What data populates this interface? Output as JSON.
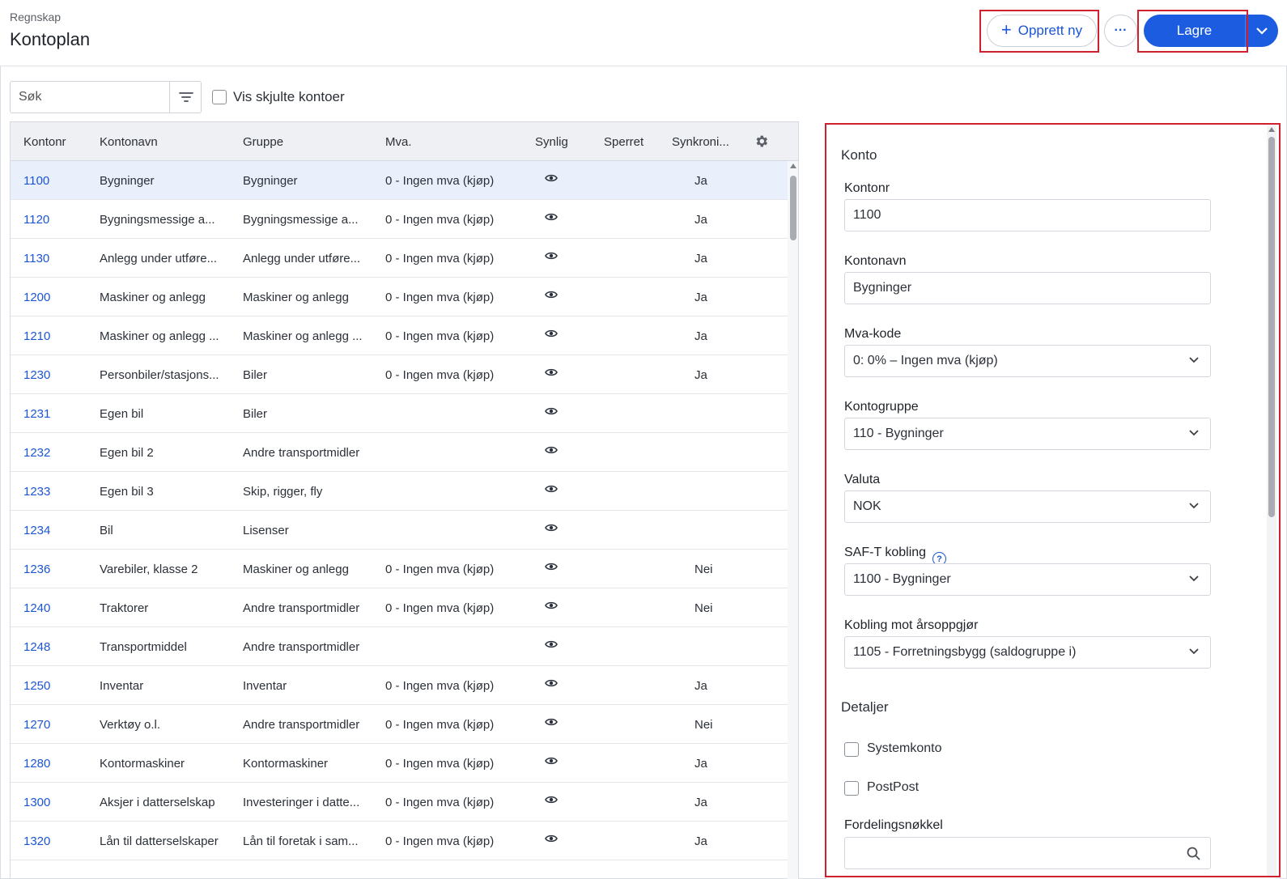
{
  "header": {
    "breadcrumb": "Regnskap",
    "title": "Kontoplan",
    "create_label": "Opprett ny",
    "more_label": "···",
    "save_label": "Lagre"
  },
  "toolbar": {
    "search_placeholder": "Søk",
    "show_hidden_label": "Vis skjulte kontoer"
  },
  "table": {
    "columns": [
      "Kontonr",
      "Kontonavn",
      "Gruppe",
      "Mva.",
      "Synlig",
      "Sperret",
      "Synkroni..."
    ],
    "rows": [
      {
        "nr": "1100",
        "name": "Bygninger",
        "group": "Bygninger",
        "mva": "0 - Ingen mva (kjøp)",
        "sync": "Ja"
      },
      {
        "nr": "1120",
        "name": "Bygningsmessige a...",
        "group": "Bygningsmessige a...",
        "mva": "0 - Ingen mva (kjøp)",
        "sync": "Ja"
      },
      {
        "nr": "1130",
        "name": "Anlegg under utføre...",
        "group": "Anlegg under utføre...",
        "mva": "0 - Ingen mva (kjøp)",
        "sync": "Ja"
      },
      {
        "nr": "1200",
        "name": "Maskiner og anlegg",
        "group": "Maskiner og anlegg",
        "mva": "0 - Ingen mva (kjøp)",
        "sync": "Ja"
      },
      {
        "nr": "1210",
        "name": "Maskiner og anlegg ...",
        "group": "Maskiner og anlegg ...",
        "mva": "0 - Ingen mva (kjøp)",
        "sync": "Ja"
      },
      {
        "nr": "1230",
        "name": "Personbiler/stasjons...",
        "group": "Biler",
        "mva": "0 - Ingen mva (kjøp)",
        "sync": "Ja"
      },
      {
        "nr": "1231",
        "name": "Egen bil",
        "group": "Biler",
        "mva": "",
        "sync": ""
      },
      {
        "nr": "1232",
        "name": "Egen bil 2",
        "group": "Andre transportmidler",
        "mva": "",
        "sync": ""
      },
      {
        "nr": "1233",
        "name": "Egen bil 3",
        "group": "Skip, rigger, fly",
        "mva": "",
        "sync": ""
      },
      {
        "nr": "1234",
        "name": "Bil",
        "group": "Lisenser",
        "mva": "",
        "sync": ""
      },
      {
        "nr": "1236",
        "name": "Varebiler, klasse 2",
        "group": "Maskiner og anlegg",
        "mva": "0 - Ingen mva (kjøp)",
        "sync": "Nei"
      },
      {
        "nr": "1240",
        "name": "Traktorer",
        "group": "Andre transportmidler",
        "mva": "0 - Ingen mva (kjøp)",
        "sync": "Nei"
      },
      {
        "nr": "1248",
        "name": "Transportmiddel",
        "group": "Andre transportmidler",
        "mva": "",
        "sync": ""
      },
      {
        "nr": "1250",
        "name": "Inventar",
        "group": "Inventar",
        "mva": "0 - Ingen mva (kjøp)",
        "sync": "Ja"
      },
      {
        "nr": "1270",
        "name": "Verktøy o.l.",
        "group": "Andre transportmidler",
        "mva": "0 - Ingen mva (kjøp)",
        "sync": "Nei"
      },
      {
        "nr": "1280",
        "name": "Kontormaskiner",
        "group": "Kontormaskiner",
        "mva": "0 - Ingen mva (kjøp)",
        "sync": "Ja"
      },
      {
        "nr": "1300",
        "name": "Aksjer i datterselskap",
        "group": "Investeringer i datte...",
        "mva": "0 - Ingen mva (kjøp)",
        "sync": "Ja"
      },
      {
        "nr": "1320",
        "name": "Lån til datterselskaper",
        "group": "Lån til foretak i sam...",
        "mva": "0 - Ingen mva (kjøp)",
        "sync": "Ja"
      }
    ]
  },
  "details": {
    "section_konto": "Konto",
    "kontonr_label": "Kontonr",
    "kontonr_value": "1100",
    "kontonavn_label": "Kontonavn",
    "kontonavn_value": "Bygninger",
    "mva_label": "Mva-kode",
    "mva_value": "0: 0% – Ingen mva (kjøp)",
    "kontogruppe_label": "Kontogruppe",
    "kontogruppe_value": "110 - Bygninger",
    "valuta_label": "Valuta",
    "valuta_value": "NOK",
    "saft_label": "SAF-T kobling",
    "saft_help": "?",
    "saft_value": "1100 - Bygninger",
    "arsoppgjor_label": "Kobling mot årsoppgjør",
    "arsoppgjor_value": "1105 - Forretningsbygg (saldogruppe i)",
    "section_detaljer": "Detaljer",
    "systemkonto_label": "Systemkonto",
    "postpost_label": "PostPost",
    "fordeling_label": "Fordelingsnøkkel"
  },
  "colors": {
    "accent": "#1c5ce0",
    "link": "#1b55d6",
    "highlight_border": "#d0202e",
    "selected_row": "#e9f0fb"
  }
}
